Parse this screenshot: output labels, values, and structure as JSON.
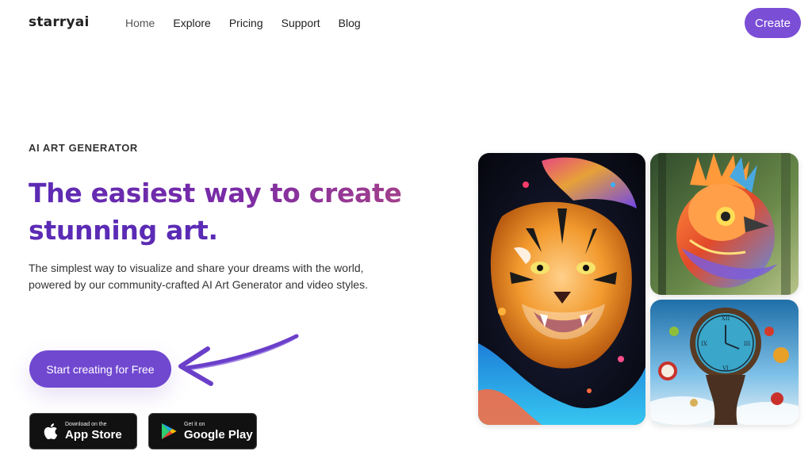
{
  "nav": {
    "logo": "starryai",
    "links": [
      "Home",
      "Explore",
      "Pricing",
      "Support",
      "Blog"
    ],
    "create_label": "Create"
  },
  "hero": {
    "eyebrow": "AI ART GENERATOR",
    "headline_line1": "The easiest way to create",
    "headline_line2": "stunning art.",
    "description": "The simplest way to visualize and share your dreams with the world, powered by our community-crafted AI Art Generator and video styles.",
    "cta_label": "Start creating for Free"
  },
  "badges": {
    "apple": {
      "small": "Download on the",
      "big": "App Store",
      "icon": "apple-icon"
    },
    "google": {
      "small": "Get it on",
      "big": "Google Play",
      "icon": "google-play-icon"
    }
  },
  "gallery": {
    "images": [
      "tiger-artwork",
      "bird-artwork",
      "clock-artwork"
    ]
  },
  "colors": {
    "accent": "#7b4ed6",
    "cta": "#7048d0",
    "headline": "#5b2bb5",
    "headline_gradient_end": "#a23f8b"
  }
}
